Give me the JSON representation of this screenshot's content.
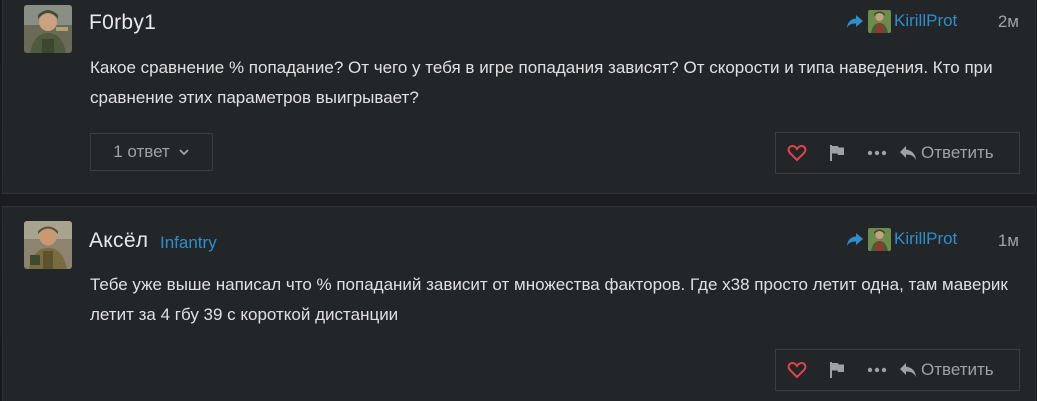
{
  "posts": [
    {
      "username": "F0rby1",
      "reply_to": "KirillProt",
      "date": "2м",
      "body": "Какое сравнение % попадание? От чего у тебя в игре попадания зависят? От скорости и типа наведения. Кто при сравнение этих параметров выигрывает?",
      "replies_label": "1 ответ",
      "reply_action": "Ответить",
      "icons": [
        "share-arrow-icon",
        "heart-icon",
        "flag-icon",
        "more-icon",
        "reply-icon",
        "chevron-down-icon"
      ]
    },
    {
      "username": "Аксёл",
      "flair": "Infantry",
      "reply_to": "KirillProt",
      "date": "1м",
      "body": "Тебе уже выше написал что % попаданий зависит от множества факторов. Где х38 просто летит одна, там маверик летит за 4 гбу 39 с короткой дистанции",
      "reply_action": "Ответить",
      "icons": [
        "share-arrow-icon",
        "heart-icon",
        "flag-icon",
        "more-icon",
        "reply-icon"
      ]
    }
  ],
  "colors": {
    "background": "#17191c",
    "post_bg": "#232629",
    "link_blue": "#2f8dcb",
    "text": "#dfe0e1",
    "muted": "#9ea2a6",
    "like_red": "#e0434b"
  }
}
